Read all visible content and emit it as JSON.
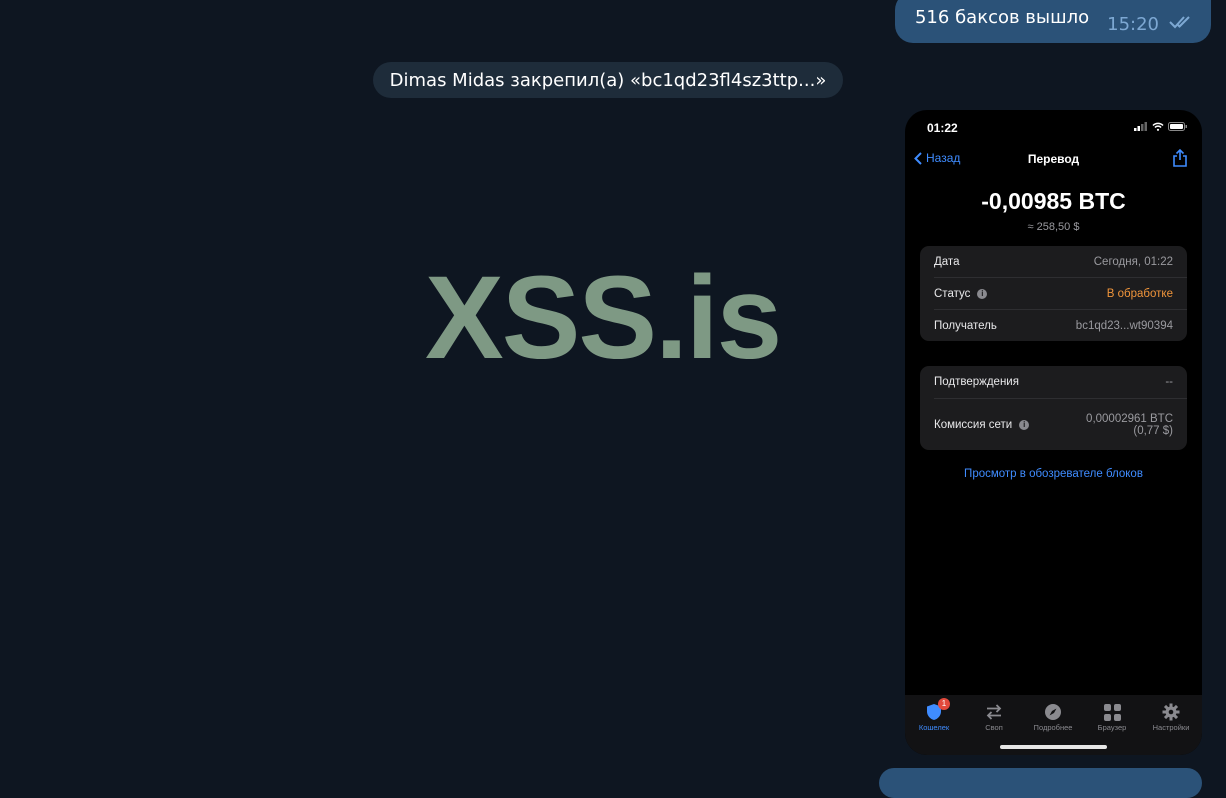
{
  "chat": {
    "outgoing_message": {
      "text": "516 баксов вышло",
      "time": "15:20"
    },
    "service_message": "Dimas Midas закрепил(а) «bc1qd23fl4sz3ttp...»",
    "watermark": "XSS.is"
  },
  "phone": {
    "status_time": "01:22",
    "nav": {
      "back_label": "Назад",
      "title": "Перевод"
    },
    "amount": "-0,00985 BTC",
    "amount_usd": "≈ 258,50 $",
    "details": [
      {
        "label": "Дата",
        "value": "Сегодня, 01:22"
      },
      {
        "label": "Статус",
        "value": "В обработке"
      },
      {
        "label": "Получатель",
        "value": "bc1qd23...wt90394"
      }
    ],
    "details2": [
      {
        "label": "Подтверждения",
        "value": "--"
      },
      {
        "label": "Комиссия сети",
        "value_line1": "0,00002961 BTC",
        "value_line2": "(0,77 $)"
      }
    ],
    "explorer_link": "Просмотр в обозревателе блоков",
    "tabs": [
      {
        "label": "Кошелек",
        "icon": "shield-icon",
        "badge": "1"
      },
      {
        "label": "Своп",
        "icon": "swap-icon"
      },
      {
        "label": "Подробнее",
        "icon": "compass-icon"
      },
      {
        "label": "Браузер",
        "icon": "grid-icon"
      },
      {
        "label": "Настройки",
        "icon": "gear-icon"
      }
    ]
  },
  "colors": {
    "chat_background": "#0e1621",
    "outgoing_bubble": "#2b5278",
    "watermark": "#7e9984",
    "accent_blue": "#3f8cff",
    "status_orange": "#f0953b"
  }
}
